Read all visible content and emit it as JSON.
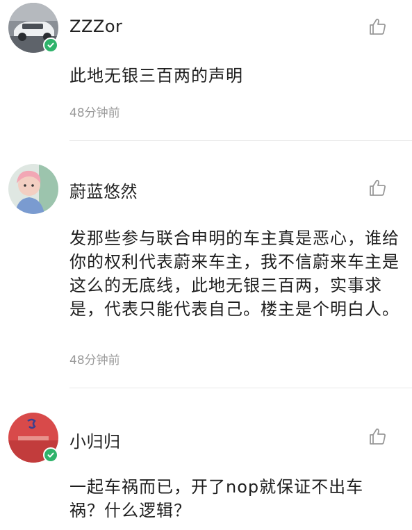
{
  "comments": [
    {
      "username": "ZZZor",
      "verified": true,
      "content": "此地无银三百两的声明",
      "time": "48分钟前"
    },
    {
      "username": "蔚蓝悠然",
      "verified": false,
      "content": "发那些参与联合申明的车主真是恶心，谁给你的权利代表蔚来车主，我不信蔚来车主是这么的无底线，此地无银三百两，实事求是，代表只能代表自己。楼主是个明白人。",
      "time": "48分钟前"
    },
    {
      "username": "小归归",
      "verified": true,
      "content": "一起车祸而已，开了nop就保证不出车祸？什么逻辑？",
      "time": ""
    }
  ],
  "colors": {
    "verified_badge": "#2fb36b",
    "time_text": "#9a9a9a",
    "divider": "#e8e8e8"
  },
  "icons": {
    "like": "thumbs-up-icon",
    "verified": "verified-check-icon"
  }
}
